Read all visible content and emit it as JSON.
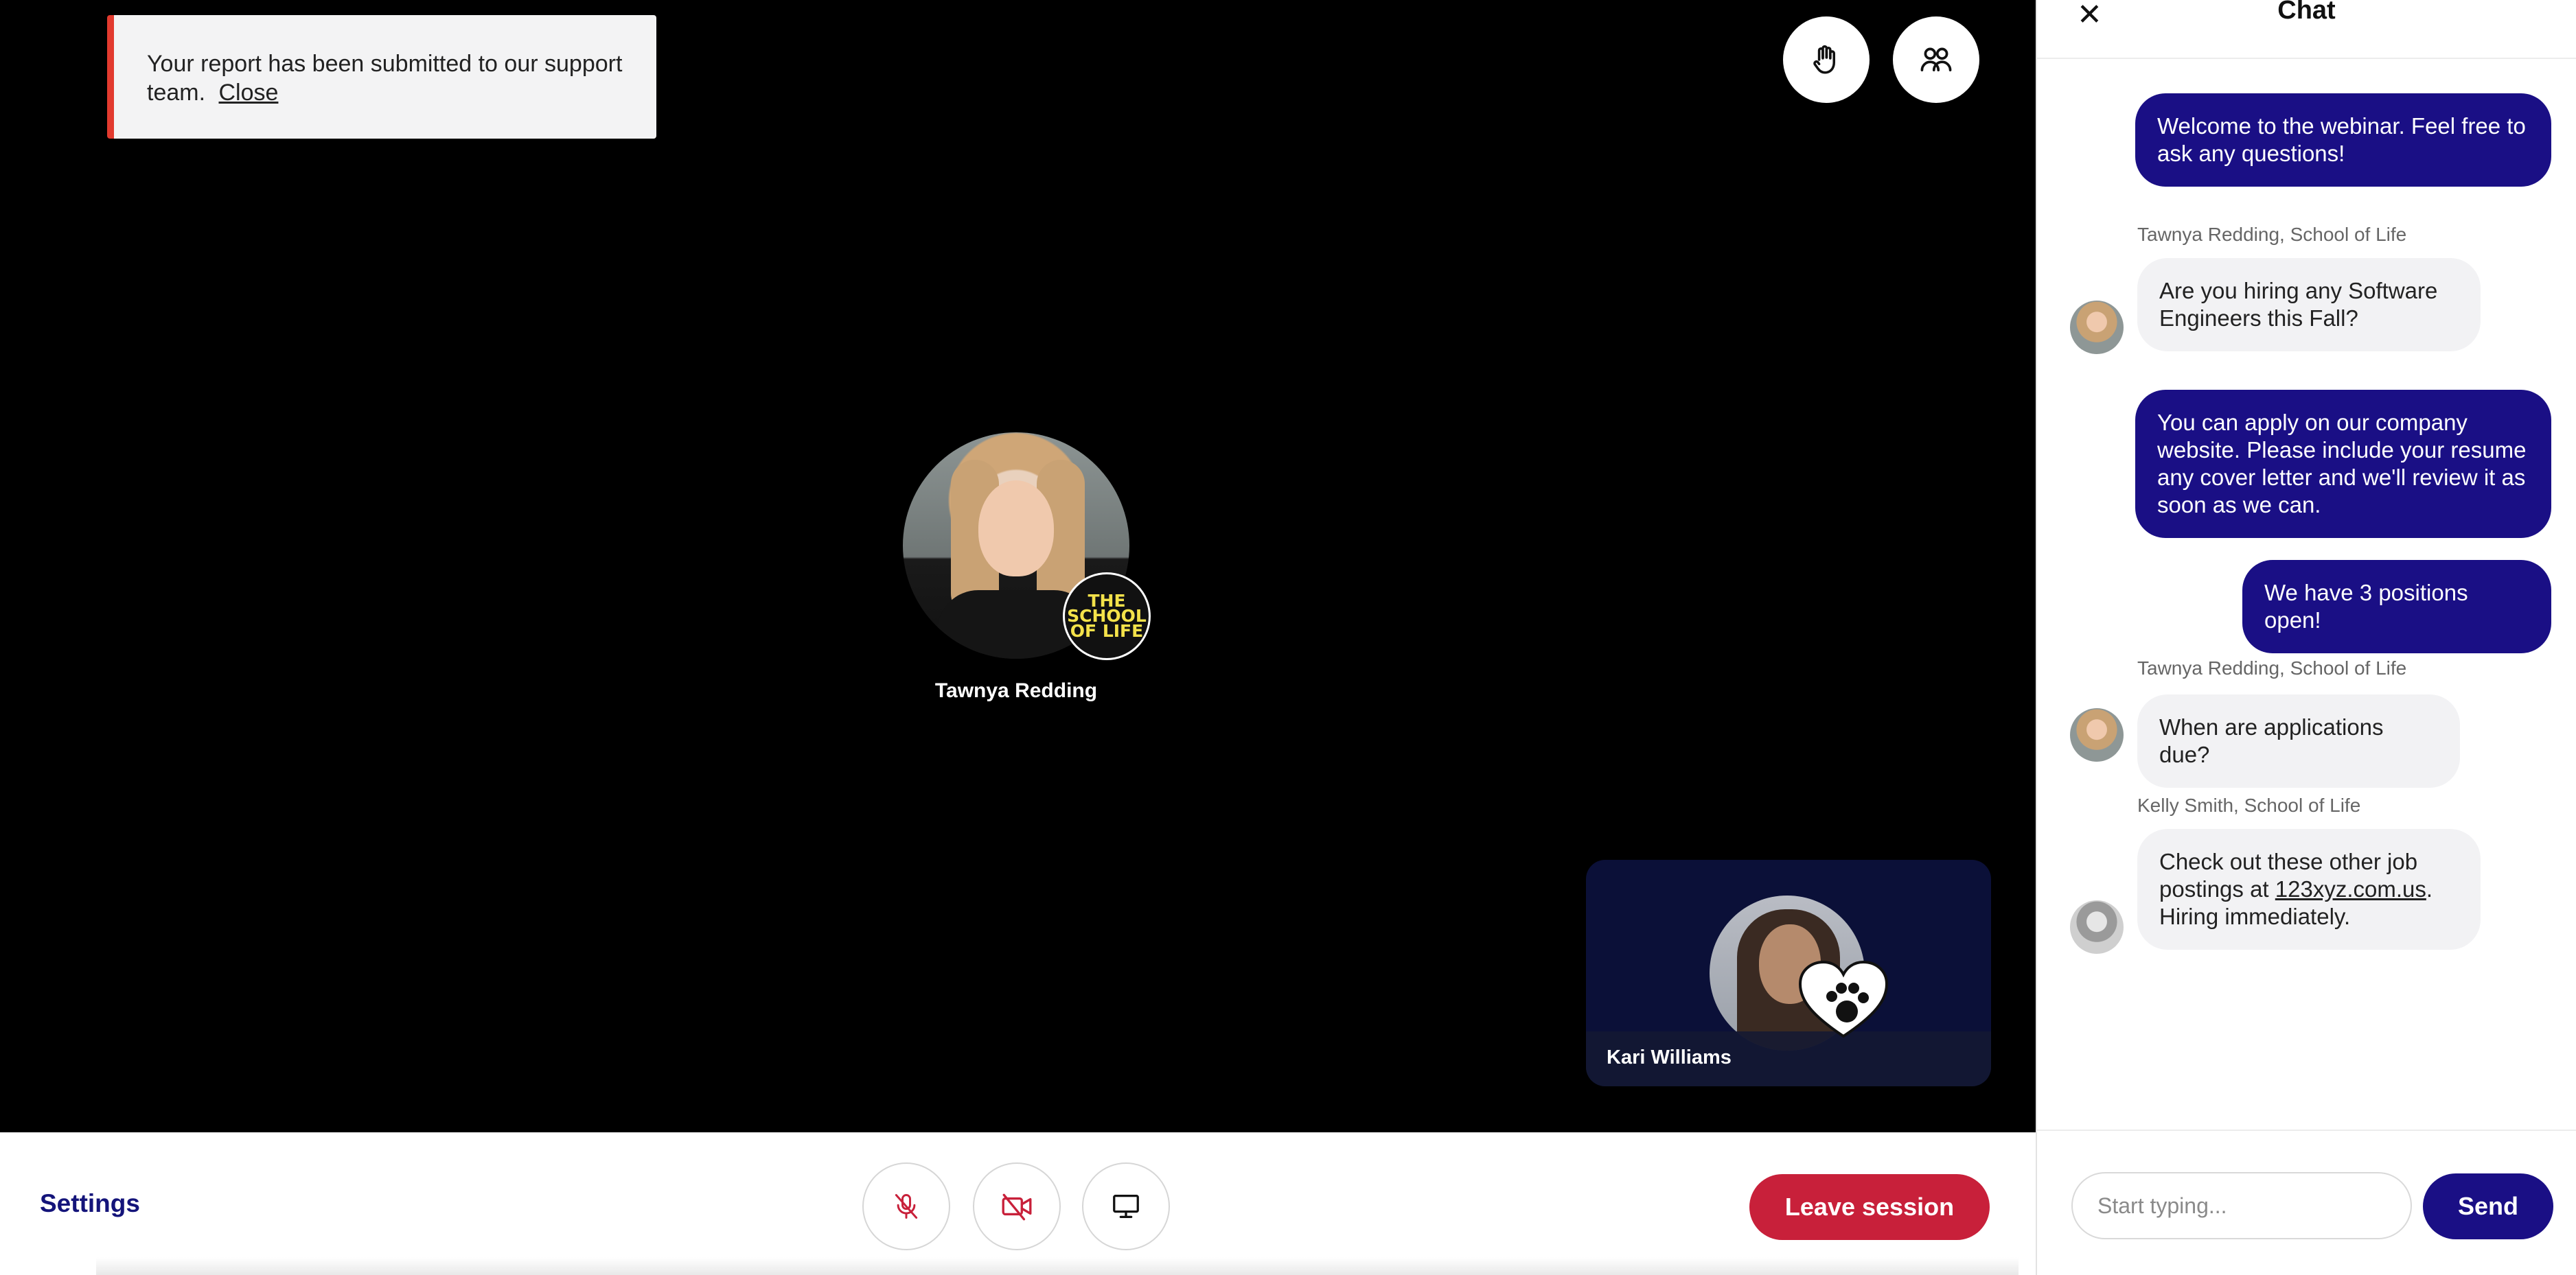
{
  "toast": {
    "message": "Your report has been submitted to our support team.",
    "close_label": "Close",
    "accent_color": "#e23a2e"
  },
  "stage": {
    "raise_hand_icon": "raise-hand-icon",
    "participants_icon": "participants-icon",
    "main_participant": {
      "name": "Tawnya Redding",
      "badge_text": [
        "THE",
        "SCHOOL",
        "OF LIFE"
      ]
    },
    "tile_participant": {
      "name": "Kari Williams",
      "badge_icon": "heart-paw-icon"
    }
  },
  "toolbar": {
    "settings_label": "Settings",
    "mic_icon": "mic-off-icon",
    "camera_icon": "camera-off-icon",
    "share_icon": "screen-share-icon",
    "leave_label": "Leave session",
    "leave_color": "#c8203a"
  },
  "chat": {
    "title": "Chat",
    "close_icon": "close-icon",
    "messages": [
      {
        "text": "Welcome to the webinar. Feel free to ask any questions!",
        "outgoing": true
      },
      {
        "sender": "Tawnya Redding, School of Life",
        "text": "Are you hiring any Software Engineers this Fall?",
        "outgoing": false
      },
      {
        "text": "You can apply on our company website. Please include your resume any cover letter and we'll review it as soon as we can.",
        "outgoing": true
      },
      {
        "text": "We have 3 positions open!",
        "outgoing": true
      },
      {
        "sender": "Tawnya Redding, School of Life",
        "text": "When are applications due?",
        "outgoing": false
      },
      {
        "sender": "Kelly Smith, School of Life",
        "text_before": "Check out these other job postings at ",
        "link": "123xyz.com.us",
        "text_after": ". Hiring immediately.",
        "outgoing": false
      }
    ],
    "input_placeholder": "Start typing...",
    "send_label": "Send",
    "brand_color": "#1a0f85"
  }
}
